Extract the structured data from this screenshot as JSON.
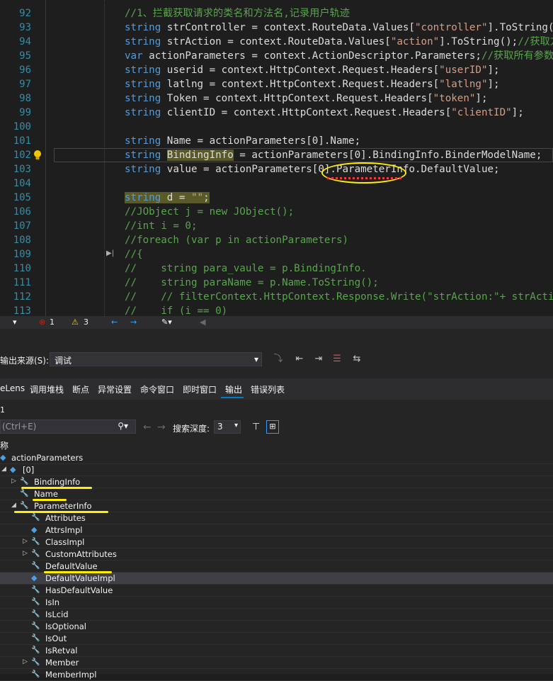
{
  "editor": {
    "lines": [
      {
        "n": "92",
        "segments": [
          [
            "cm",
            "//1、拦截获取请求的类名和方法名,记录用户轨迹"
          ]
        ]
      },
      {
        "n": "93",
        "segments": [
          [
            "kw",
            "string"
          ],
          [
            "id",
            " strController = context.RouteData.Values["
          ],
          [
            "st",
            "\"controller\""
          ],
          [
            "id",
            "].ToString();"
          ],
          [
            "cm",
            "//"
          ]
        ]
      },
      {
        "n": "94",
        "segments": [
          [
            "kw",
            "string"
          ],
          [
            "id",
            " strAction = context.RouteData.Values["
          ],
          [
            "st",
            "\"action\""
          ],
          [
            "id",
            "].ToString();"
          ],
          [
            "cm",
            "//获取方法"
          ]
        ]
      },
      {
        "n": "95",
        "segments": [
          [
            "kw",
            "var"
          ],
          [
            "id",
            " actionParameters = context.ActionDescriptor.Parameters;"
          ],
          [
            "cm",
            "//获取所有参数"
          ]
        ]
      },
      {
        "n": "96",
        "segments": [
          [
            "kw",
            "string"
          ],
          [
            "id",
            " userid = context.HttpContext.Request.Headers["
          ],
          [
            "st",
            "\"userID\""
          ],
          [
            "id",
            "];"
          ]
        ]
      },
      {
        "n": "97",
        "segments": [
          [
            "kw",
            "string"
          ],
          [
            "id",
            " latlng = context.HttpContext.Request.Headers["
          ],
          [
            "st",
            "\"latlng\""
          ],
          [
            "id",
            "];"
          ]
        ]
      },
      {
        "n": "98",
        "segments": [
          [
            "kw",
            "string"
          ],
          [
            "id",
            " Token = context.HttpContext.Request.Headers["
          ],
          [
            "st",
            "\"token\""
          ],
          [
            "id",
            "];"
          ]
        ]
      },
      {
        "n": "99",
        "segments": [
          [
            "kw",
            "string"
          ],
          [
            "id",
            " clientID = context.HttpContext.Request.Headers["
          ],
          [
            "st",
            "\"clientID\""
          ],
          [
            "id",
            "];"
          ]
        ]
      },
      {
        "n": "100",
        "segments": []
      },
      {
        "n": "101",
        "segments": [
          [
            "kw",
            "string"
          ],
          [
            "id",
            " Name = actionParameters[0].Name;"
          ]
        ]
      },
      {
        "n": "102",
        "segments": [
          [
            "kw",
            "string"
          ],
          [
            "id",
            " "
          ],
          [
            "hl",
            "BindingInfo"
          ],
          [
            "id",
            " = actionParameters[0].BindingInfo.BinderModelName;"
          ]
        ]
      },
      {
        "n": "103",
        "segments": [
          [
            "kw",
            "string"
          ],
          [
            "id",
            " value = actionParameters[0].ParameterInfo.DefaultValue;"
          ]
        ]
      },
      {
        "n": "104",
        "segments": []
      },
      {
        "n": "105",
        "segments": [
          [
            "hlkw",
            "string"
          ],
          [
            "hl",
            " d = "
          ],
          [
            "hlst",
            "\"\""
          ],
          [
            "hl",
            ";"
          ]
        ]
      },
      {
        "n": "106",
        "segments": [
          [
            "cm",
            "//JObject j = new JObject();"
          ]
        ]
      },
      {
        "n": "107",
        "segments": [
          [
            "cm",
            "//int i = 0;"
          ]
        ]
      },
      {
        "n": "108",
        "segments": [
          [
            "cm",
            "//foreach (var p in actionParameters)"
          ]
        ]
      },
      {
        "n": "109",
        "segments": [
          [
            "cm",
            "//{"
          ]
        ]
      },
      {
        "n": "110",
        "segments": [
          [
            "cm",
            "//    string para_vaule = p.BindingInfo."
          ]
        ]
      },
      {
        "n": "111",
        "segments": [
          [
            "cm",
            "//    string paraName = p.Name.ToString();"
          ]
        ]
      },
      {
        "n": "112",
        "segments": [
          [
            "cm",
            "//    // filterContext.HttpContext.Response.Write(\"strAction:\"+ strAction+\""
          ]
        ]
      },
      {
        "n": "113",
        "segments": [
          [
            "cm",
            "//    if (i == 0)"
          ]
        ]
      }
    ]
  },
  "statusbar": {
    "errors": "1",
    "warnings": "3"
  },
  "output": {
    "source_label": "输出来源(S):",
    "source_value": "调试"
  },
  "tabs": [
    "eLens",
    "调用堆栈",
    "断点",
    "异常设置",
    "命令窗口",
    "即时窗口",
    "输出",
    "错误列表"
  ],
  "active_tab": "输出",
  "watch": {
    "count": "1",
    "search_placeholder": "(Ctrl+E)",
    "depth_label": "搜索深度:",
    "depth_value": "3",
    "name_header": "称",
    "root": "actionParameters",
    "index": "[0]",
    "items": [
      {
        "label": "BindingInfo",
        "level": 1,
        "expand": "right",
        "icon": "wrench"
      },
      {
        "label": "Name",
        "level": 1,
        "expand": "",
        "icon": "wrench"
      },
      {
        "label": "ParameterInfo",
        "level": 1,
        "expand": "down",
        "icon": "wrench"
      },
      {
        "label": "Attributes",
        "level": 2,
        "expand": "",
        "icon": "wrench"
      },
      {
        "label": "AttrsImpl",
        "level": 2,
        "expand": "",
        "icon": "field"
      },
      {
        "label": "ClassImpl",
        "level": 2,
        "expand": "right",
        "icon": "wrench"
      },
      {
        "label": "CustomAttributes",
        "level": 2,
        "expand": "right",
        "icon": "wrench"
      },
      {
        "label": "DefaultValue",
        "level": 2,
        "expand": "",
        "icon": "wrench"
      },
      {
        "label": "DefaultValueImpl",
        "level": 2,
        "expand": "",
        "icon": "field"
      },
      {
        "label": "HasDefaultValue",
        "level": 2,
        "expand": "",
        "icon": "wrench"
      },
      {
        "label": "IsIn",
        "level": 2,
        "expand": "",
        "icon": "wrench"
      },
      {
        "label": "IsLcid",
        "level": 2,
        "expand": "",
        "icon": "wrench"
      },
      {
        "label": "IsOptional",
        "level": 2,
        "expand": "",
        "icon": "wrench"
      },
      {
        "label": "IsOut",
        "level": 2,
        "expand": "",
        "icon": "wrench"
      },
      {
        "label": "IsRetval",
        "level": 2,
        "expand": "",
        "icon": "wrench"
      },
      {
        "label": "Member",
        "level": 2,
        "expand": "right",
        "icon": "wrench"
      },
      {
        "label": "MemberImpl",
        "level": 2,
        "expand": "",
        "icon": "wrench"
      }
    ]
  },
  "colors": {
    "keyword": "#569cd6",
    "comment": "#57a64a",
    "string": "#d69d85",
    "annotation": "#ffee00"
  }
}
